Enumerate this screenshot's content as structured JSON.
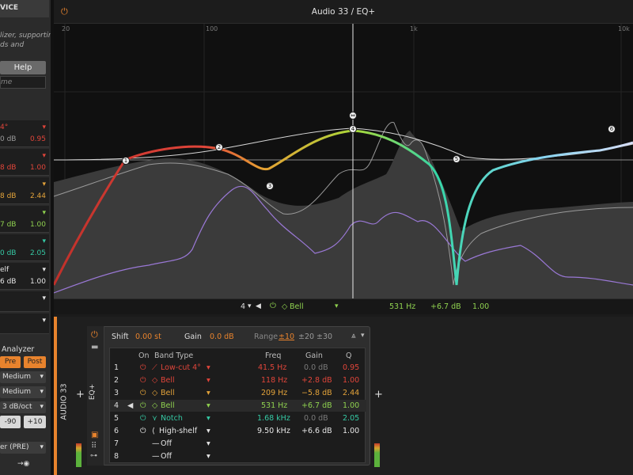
{
  "left_panel": {
    "device_label": "VICE",
    "description_lines": [
      "lizer, supporting",
      "ds and"
    ],
    "help_button": "Help",
    "name_placeholder": "me",
    "bands": [
      {
        "name": "4°",
        "gain": "",
        "q": "0.95",
        "color": "#e0453a",
        "prefix": ""
      },
      {
        "name": "",
        "gain": "0 dB",
        "q": "",
        "color": "#9a9a9a",
        "prefix": ""
      },
      {
        "name": "",
        "gain": "8 dB",
        "q": "1.00",
        "color": "#e0453a",
        "prefix": ""
      },
      {
        "name": "",
        "gain": "8 dB",
        "q": "2.44",
        "color": "#e3a33a",
        "prefix": ""
      },
      {
        "name": "",
        "gain": "7 dB",
        "q": "1.00",
        "color": "#8fd14f",
        "prefix": ""
      },
      {
        "name": "",
        "gain": "0 dB",
        "q": "2.05",
        "color": "#35c9a4",
        "prefix": ""
      },
      {
        "name": "elf",
        "gain": "6 dB",
        "q": "1.00",
        "color": "#d9d9d9",
        "prefix": ""
      }
    ],
    "analyzer_label": "Analyzer",
    "pre_label": "Pre",
    "post_label": "Post",
    "medium1": "Medium",
    "medium2": "Medium",
    "slope": "3 dB/oct",
    "range_low": "-90",
    "range_high": "+10",
    "mode": "er (PRE)"
  },
  "graph": {
    "title": "Audio 33 / EQ+",
    "freq_labels": [
      "20",
      "100",
      "1k",
      "10k"
    ],
    "band_markers": [
      "1",
      "2",
      "3",
      "4",
      "5",
      "6"
    ],
    "readout": {
      "band_num": "4",
      "band_type": "Bell",
      "freq": "531 Hz",
      "gain": "+6.7 dB",
      "q": "1.00"
    }
  },
  "track": {
    "name": "AUDIO 33",
    "eq_label": "EQ+"
  },
  "device": {
    "shift_label": "Shift",
    "shift_value": "0.00 st",
    "gain_label": "Gain",
    "gain_value": "0.0 dB",
    "range_label": "Range",
    "range_options": [
      "±10",
      "±20",
      "±30"
    ],
    "headers": {
      "on": "On",
      "band_type": "Band Type",
      "freq": "Freq",
      "gain": "Gain",
      "q": "Q"
    },
    "rows": [
      {
        "num": "1",
        "type": "Low-cut 4°",
        "freq": "41.5 Hz",
        "gain": "0.0 dB",
        "q": "0.95",
        "color": "#e0453a",
        "gaincolor": "#7a7a7a"
      },
      {
        "num": "2",
        "type": "Bell",
        "freq": "118 Hz",
        "gain": "+2.8 dB",
        "q": "1.00",
        "color": "#e0453a",
        "gaincolor": "#e0453a"
      },
      {
        "num": "3",
        "type": "Bell",
        "freq": "209 Hz",
        "gain": "−5.8 dB",
        "q": "2.44",
        "color": "#e3a33a",
        "gaincolor": "#e3a33a"
      },
      {
        "num": "4",
        "type": "Bell",
        "freq": "531 Hz",
        "gain": "+6.7 dB",
        "q": "1.00",
        "color": "#8fd14f",
        "gaincolor": "#8fd14f"
      },
      {
        "num": "5",
        "type": "Notch",
        "freq": "1.68 kHz",
        "gain": "0.0 dB",
        "q": "2.05",
        "color": "#35c9a4",
        "gaincolor": "#7a7a7a"
      },
      {
        "num": "6",
        "type": "High-shelf",
        "freq": "9.50 kHz",
        "gain": "+6.6 dB",
        "q": "1.00",
        "color": "#e6e6e6",
        "gaincolor": "#e6e6e6"
      },
      {
        "num": "7",
        "type": "Off",
        "freq": "",
        "gain": "",
        "q": "",
        "color": "#e6e6e6",
        "gaincolor": "#e6e6e6"
      },
      {
        "num": "8",
        "type": "Off",
        "freq": "",
        "gain": "",
        "q": "",
        "color": "#e6e6e6",
        "gaincolor": "#e6e6e6"
      }
    ]
  }
}
